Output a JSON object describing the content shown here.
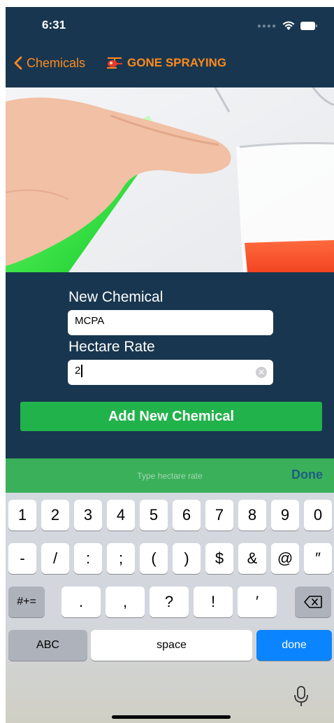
{
  "status_bar": {
    "time": "6:31"
  },
  "nav": {
    "back_label": "Chemicals",
    "brand_title": "GONE SPRAYING"
  },
  "form": {
    "chemical_label": "New Chemical",
    "chemical_value": "MCPA",
    "rate_label": "Hectare Rate",
    "rate_value": "2",
    "add_button": "Add New Chemical"
  },
  "accessory": {
    "placeholder": "Type hectare rate",
    "done": "Done"
  },
  "keyboard": {
    "row1": [
      "1",
      "2",
      "3",
      "4",
      "5",
      "6",
      "7",
      "8",
      "9",
      "0"
    ],
    "row2": [
      "-",
      "/",
      ":",
      ";",
      "(",
      ")",
      "$",
      "&",
      "@",
      "″"
    ],
    "symbols_toggle": "#+=",
    "row3": [
      ".",
      ",",
      "?",
      "!",
      "′"
    ],
    "abc": "ABC",
    "space": "space",
    "done": "done"
  },
  "colors": {
    "header_bg": "#18364f",
    "accent_orange": "#ff8a1d",
    "button_green": "#22b24b",
    "accessory_green": "#3ab05a",
    "keyboard_blue": "#0a84ff"
  },
  "icons": [
    "back-chevron-icon",
    "helicopter-icon",
    "wifi-icon",
    "battery-icon",
    "clear-icon",
    "backspace-icon",
    "microphone-icon"
  ]
}
